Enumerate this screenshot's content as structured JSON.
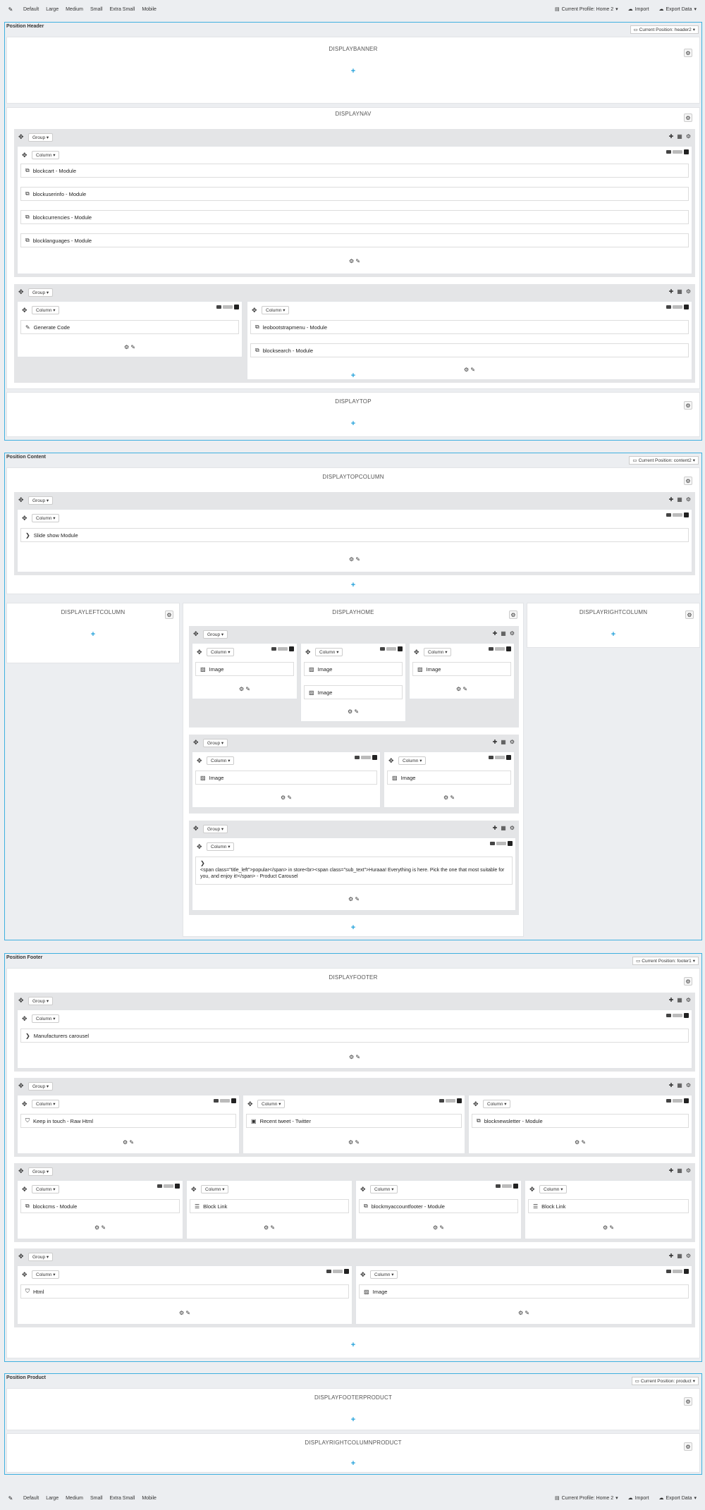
{
  "toolbar": {
    "edit_icon": "pencil-icon",
    "devices": [
      "Default",
      "Large",
      "Medium",
      "Small",
      "Extra Small",
      "Mobile"
    ],
    "profile_label": "Current Profile: Home 2",
    "import_label": "Import",
    "export_label": "Export Data"
  },
  "positions": {
    "header": {
      "title": "Position Header",
      "current": "Current Position: header2"
    },
    "content": {
      "title": "Position Content",
      "current": "Current Position: content2"
    },
    "footer": {
      "title": "Position Footer",
      "current": "Current Position: footer1"
    },
    "product": {
      "title": "Position Product",
      "current": "Current Position: product"
    }
  },
  "hooks": {
    "displaybanner": "DISPLAYBANNER",
    "displaynav": "DISPLAYNAV",
    "displaytop": "DISPLAYTOP",
    "displaytopcolumn": "DISPLAYTOPCOLUMN",
    "displayleftcolumn": "DISPLAYLEFTCOLUMN",
    "displayhome": "DISPLAYHOME",
    "displayrightcolumn": "DISPLAYRIGHTCOLUMN",
    "displayfooter": "DISPLAYFOOTER",
    "displayfooterproduct": "DISPLAYFOOTERPRODUCT",
    "displayrightcolumnproduct": "DISPLAYRIGHTCOLUMNPRODUCT"
  },
  "labels": {
    "group": "Group ▾",
    "column": "Column ▾",
    "plus": "+"
  },
  "widgets": {
    "blockcart": "blockcart - Module",
    "blockuserinfo": "blockuserinfo - Module",
    "blockcurrencies": "blockcurrencies - Module",
    "blocklanguages": "blocklanguages - Module",
    "generate_code": "Generate Code",
    "leobootstrapmenu": "leobootstrapmenu - Module",
    "blocksearch": "blocksearch - Module",
    "slideshow": "Slide show Module",
    "image": "Image",
    "carousel": "<span class=\"title_left\">popular</span> in store<br><span class=\"sub_text\">Huraaa! Everything is here. Pick the one that most suitable for you, and enjoy it!</span> - Product Carousel",
    "manufacturers": "Manufacturers carousel",
    "keep_in_touch": "Keep in touch - Raw Html",
    "recent_tweet": "Recent tweet - Twitter",
    "blocknewsletter": "blocknewsletter - Module",
    "blockcms": "blockcms - Module",
    "block_link": "Block Link",
    "blockmyaccountfooter": "blockmyaccountfooter - Module",
    "html": "Html"
  }
}
